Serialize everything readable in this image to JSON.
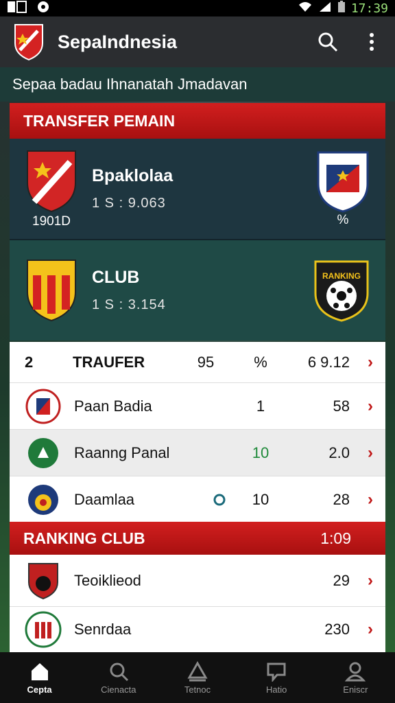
{
  "status_bar": {
    "time": "17:39"
  },
  "app_bar": {
    "title": "SepaIndnesia"
  },
  "subtitle": "Sepaa badau Ihnanatah   Jmadavan",
  "transfer_section": {
    "header": "TRANSFER PEMAIN",
    "cards": [
      {
        "name": "Bpaklolaa",
        "stats": "1  S : 9.063",
        "foot_left": "1901D",
        "foot_right": "%"
      },
      {
        "name": "CLUB",
        "stats": "1  S : 3.154",
        "foot_left": "",
        "foot_right": ""
      }
    ],
    "crest_text": "RANKING"
  },
  "table": {
    "head": {
      "rank": "2",
      "label": "TRAUFER",
      "a": "95",
      "b": "%",
      "c": "6 9.12"
    },
    "rows": [
      {
        "name": "Paan Badia",
        "a": "1",
        "b": "58"
      },
      {
        "name": "Raanng Panal",
        "a": "10",
        "b": "2.0"
      },
      {
        "name": "Daamlaa",
        "a": "10",
        "b": "28"
      }
    ]
  },
  "ranking_section": {
    "header": "RANKING CLUB",
    "time": "1:09",
    "rows": [
      {
        "name": "Teoiklieod",
        "b": "29"
      },
      {
        "name": "Senrdaa",
        "b": "230"
      }
    ]
  },
  "bottom_nav": [
    {
      "label": "Cepta",
      "icon": "home-icon"
    },
    {
      "label": "Cienacta",
      "icon": "search-icon"
    },
    {
      "label": "Tetnoc",
      "icon": "upload-icon"
    },
    {
      "label": "Hatio",
      "icon": "chat-icon"
    },
    {
      "label": "Eniscr",
      "icon": "user-icon"
    }
  ],
  "colors": {
    "accent_red": "#c81818",
    "teal": "#1f4a46",
    "dark_card": "#1e3640"
  }
}
